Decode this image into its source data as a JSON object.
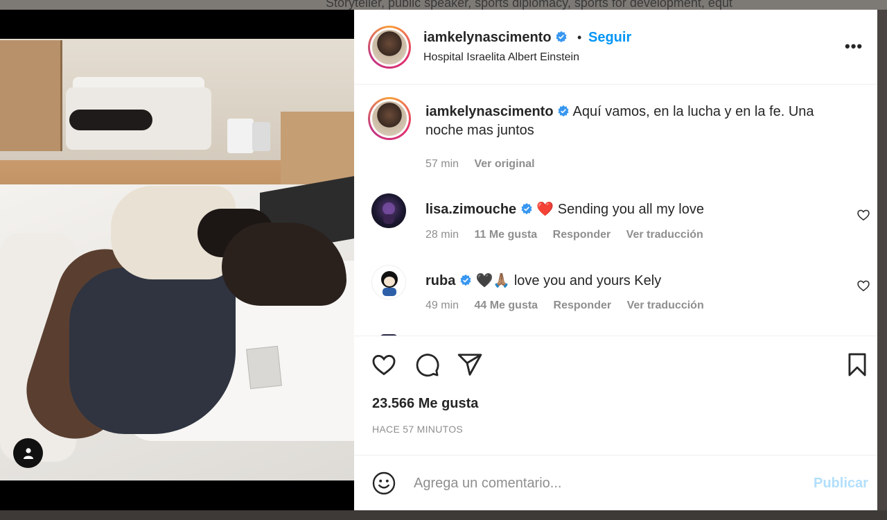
{
  "background": {
    "top_text": "Storyteller, public speaker, sports diplomacy, sports for development, equt"
  },
  "post": {
    "username": "iamkelynascimento",
    "separator": "•",
    "follow_label": "Seguir",
    "location": "Hospital Israelita Albert Einstein",
    "more_label": "•••",
    "caption": {
      "username": "iamkelynascimento",
      "text": "Aquí vamos, en la lucha y en la fe. Una noche mas juntos",
      "time": "57 min",
      "see_original": "Ver original"
    },
    "comments": [
      {
        "username": "lisa.zimouche",
        "emoji": "❤️",
        "text": "Sending you all my love",
        "time": "28 min",
        "likes": "11 Me gusta",
        "reply": "Responder",
        "translate": "Ver traducción"
      },
      {
        "username": "ruba",
        "emoji": "🖤🙏🏽",
        "text": "love you and yours Kely",
        "time": "49 min",
        "likes": "44 Me gusta",
        "reply": "Responder",
        "translate": "Ver traducción"
      }
    ],
    "like_count": "23.566 Me gusta",
    "posted_ago": "HACE 57 MINUTOS",
    "comment_placeholder": "Agrega un comentario...",
    "publish_label": "Publicar"
  },
  "colors": {
    "accent_blue": "#0095f6",
    "publish_disabled": "#b2dffc",
    "secondary_text": "#8e8e8e",
    "heart_red": "#ed4956"
  },
  "icons": [
    "verified-icon",
    "more-options-icon",
    "heart-icon",
    "comment-icon",
    "share-icon",
    "bookmark-icon",
    "emoji-icon",
    "user-tag-icon"
  ]
}
